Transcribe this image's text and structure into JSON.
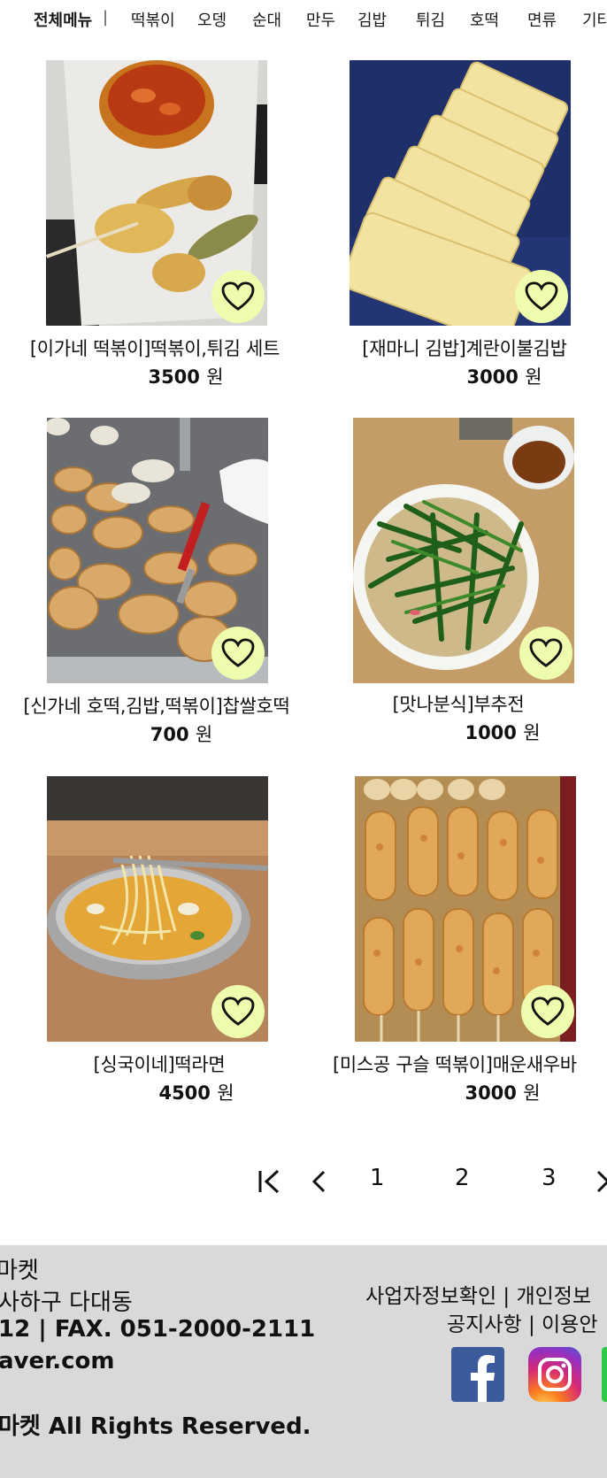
{
  "category_nav": {
    "all_label": "전체메뉴",
    "separator": "|",
    "items": [
      "떡볶이",
      "오뎅",
      "순대",
      "만두",
      "김밥",
      "튀김",
      "호떡",
      "면류",
      "기타"
    ]
  },
  "products": [
    {
      "name": "[이가네 떡볶이]떡볶이,튀김 세트",
      "price": "3500",
      "unit": "원"
    },
    {
      "name": "[재마니 김밥]계란이불김밥",
      "price": "3000",
      "unit": "원"
    },
    {
      "name": "[신가네 호떡,김밥,떡볶이]찹쌀호떡",
      "price": "700",
      "unit": "원"
    },
    {
      "name": "[맛나분식]부추전",
      "price": "1000",
      "unit": "원"
    },
    {
      "name": "[싱국이네]떡라면",
      "price": "4500",
      "unit": "원"
    },
    {
      "name": "[미스공 구슬 떡볶이]매운새우바",
      "price": "3000",
      "unit": "원"
    }
  ],
  "pagination": {
    "pages": [
      "1",
      "2",
      "3"
    ]
  },
  "footer": {
    "company": "마켓",
    "address": "사하구 다대동",
    "contact": "12  |  FAX. 051-2000-2111",
    "email": "aver.com",
    "copyright": "마켓 All Rights Reserved.",
    "links_row1": "사업자정보확인  |  개인정보",
    "links_row2": "공지사항  |  이용안",
    "social": [
      "facebook-icon",
      "instagram-icon",
      "other-sns-icon"
    ]
  },
  "colors": {
    "heart_bg": "#eefcae",
    "footer_bg": "#d9d9d9",
    "facebook": "#3b5b9c",
    "other_sns": "#2fc94a"
  }
}
